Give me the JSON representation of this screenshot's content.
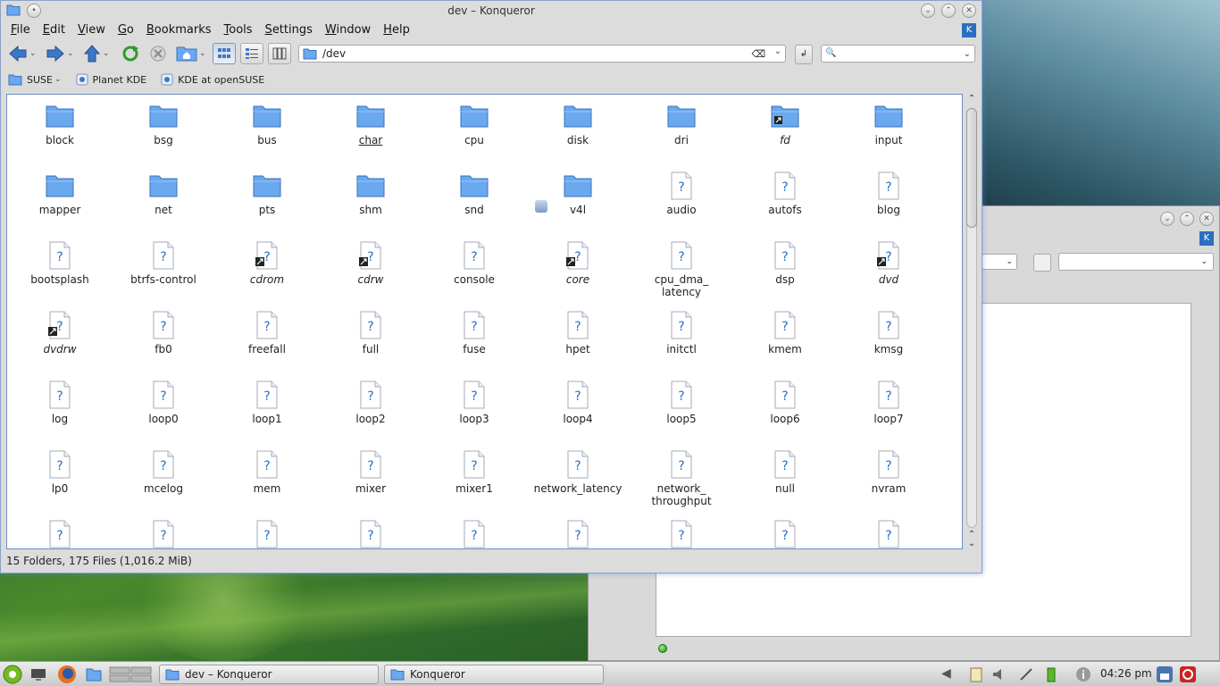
{
  "window": {
    "title": "dev – Konqueror"
  },
  "menu": [
    "File",
    "Edit",
    "View",
    "Go",
    "Bookmarks",
    "Tools",
    "Settings",
    "Window",
    "Help"
  ],
  "location": {
    "value": "/dev",
    "search_placeholder": ""
  },
  "bookmarks": [
    {
      "label": "SUSE",
      "icon": "folder-icon"
    },
    {
      "label": "Planet KDE",
      "icon": "web-icon"
    },
    {
      "label": "KDE at openSUSE",
      "icon": "web-icon"
    }
  ],
  "files": [
    {
      "name": "block",
      "type": "folder"
    },
    {
      "name": "bsg",
      "type": "folder"
    },
    {
      "name": "bus",
      "type": "folder"
    },
    {
      "name": "char",
      "type": "folder",
      "style": "ul"
    },
    {
      "name": "cpu",
      "type": "folder"
    },
    {
      "name": "disk",
      "type": "folder"
    },
    {
      "name": "dri",
      "type": "folder"
    },
    {
      "name": "fd",
      "type": "folder-link",
      "style": "italic"
    },
    {
      "name": "input",
      "type": "folder"
    },
    {
      "name": "mapper",
      "type": "folder"
    },
    {
      "name": "net",
      "type": "folder"
    },
    {
      "name": "pts",
      "type": "folder"
    },
    {
      "name": "shm",
      "type": "folder"
    },
    {
      "name": "snd",
      "type": "folder"
    },
    {
      "name": "v4l",
      "type": "folder"
    },
    {
      "name": "audio",
      "type": "unknown"
    },
    {
      "name": "autofs",
      "type": "unknown"
    },
    {
      "name": "blog",
      "type": "unknown"
    },
    {
      "name": "bootsplash",
      "type": "unknown"
    },
    {
      "name": "btrfs-control",
      "type": "unknown"
    },
    {
      "name": "cdrom",
      "type": "unknown-link",
      "style": "italic"
    },
    {
      "name": "cdrw",
      "type": "unknown-link",
      "style": "italic"
    },
    {
      "name": "console",
      "type": "unknown"
    },
    {
      "name": "core",
      "type": "unknown-link",
      "style": "italic"
    },
    {
      "name": "cpu_dma_\nlatency",
      "type": "unknown"
    },
    {
      "name": "dsp",
      "type": "unknown"
    },
    {
      "name": "dvd",
      "type": "unknown-link",
      "style": "italic"
    },
    {
      "name": "dvdrw",
      "type": "unknown-link",
      "style": "italic"
    },
    {
      "name": "fb0",
      "type": "unknown"
    },
    {
      "name": "freefall",
      "type": "unknown"
    },
    {
      "name": "full",
      "type": "unknown"
    },
    {
      "name": "fuse",
      "type": "unknown"
    },
    {
      "name": "hpet",
      "type": "unknown"
    },
    {
      "name": "initctl",
      "type": "unknown"
    },
    {
      "name": "kmem",
      "type": "unknown"
    },
    {
      "name": "kmsg",
      "type": "unknown"
    },
    {
      "name": "log",
      "type": "unknown"
    },
    {
      "name": "loop0",
      "type": "unknown"
    },
    {
      "name": "loop1",
      "type": "unknown"
    },
    {
      "name": "loop2",
      "type": "unknown"
    },
    {
      "name": "loop3",
      "type": "unknown"
    },
    {
      "name": "loop4",
      "type": "unknown"
    },
    {
      "name": "loop5",
      "type": "unknown"
    },
    {
      "name": "loop6",
      "type": "unknown"
    },
    {
      "name": "loop7",
      "type": "unknown"
    },
    {
      "name": "lp0",
      "type": "unknown"
    },
    {
      "name": "mcelog",
      "type": "unknown"
    },
    {
      "name": "mem",
      "type": "unknown"
    },
    {
      "name": "mixer",
      "type": "unknown"
    },
    {
      "name": "mixer1",
      "type": "unknown"
    },
    {
      "name": "network_latency",
      "type": "unknown"
    },
    {
      "name": "network_\nthroughput",
      "type": "unknown"
    },
    {
      "name": "null",
      "type": "unknown"
    },
    {
      "name": "nvram",
      "type": "unknown"
    },
    {
      "name": "",
      "type": "unknown"
    },
    {
      "name": "",
      "type": "unknown"
    },
    {
      "name": "",
      "type": "unknown"
    },
    {
      "name": "",
      "type": "unknown"
    },
    {
      "name": "",
      "type": "unknown"
    },
    {
      "name": "",
      "type": "unknown"
    },
    {
      "name": "",
      "type": "unknown"
    },
    {
      "name": "",
      "type": "unknown"
    },
    {
      "name": "",
      "type": "unknown"
    }
  ],
  "status": "15 Folders, 175 Files (1,016.2 MiB)",
  "taskbar": {
    "tasks": [
      {
        "label": "dev – Konqueror"
      },
      {
        "label": "Konqueror"
      }
    ],
    "clock": "04:26 pm"
  },
  "colors": {
    "folder": "#6aa8f0",
    "accent": "#2a6fc0",
    "link_badge": "#222222"
  }
}
